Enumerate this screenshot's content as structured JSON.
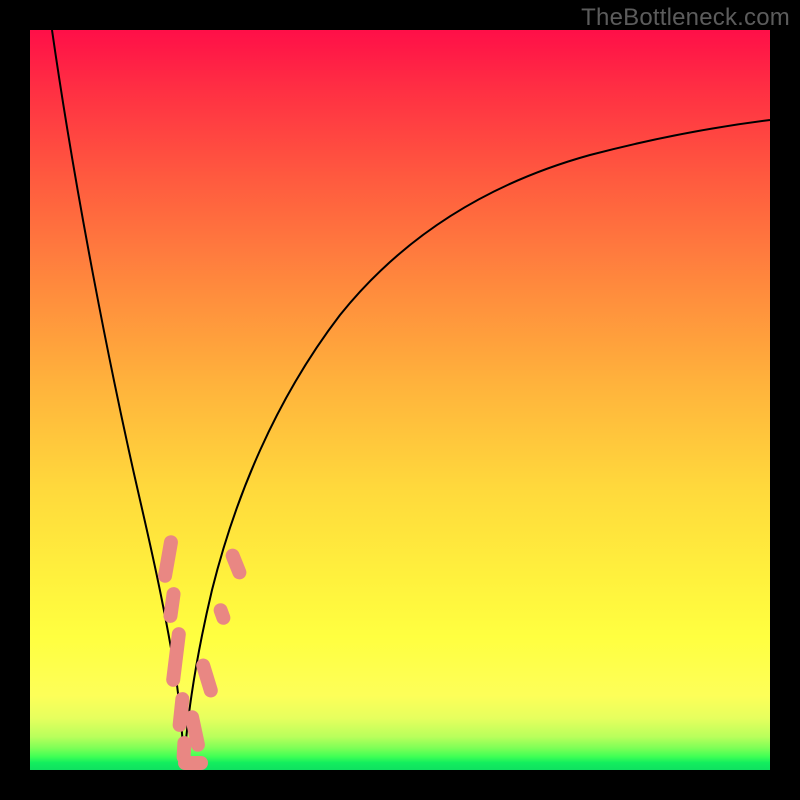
{
  "watermark": "TheBottleneck.com",
  "colors": {
    "frame": "#000000",
    "nugget": "#e98783",
    "curve": "#000000"
  },
  "chart_data": {
    "type": "line",
    "title": "",
    "xlabel": "",
    "ylabel": "",
    "xlim": [
      0,
      100
    ],
    "ylim": [
      0,
      100
    ],
    "grid": false,
    "series": [
      {
        "name": "left-branch",
        "x": [
          3,
          6,
          9,
          12,
          14,
          16,
          17.5,
          18.8,
          19.7,
          20.4,
          20.7
        ],
        "y": [
          100,
          75,
          54,
          36,
          24,
          16,
          10,
          6,
          3.5,
          1.5,
          0.6
        ]
      },
      {
        "name": "right-branch",
        "x": [
          20.7,
          21.5,
          23,
          25,
          28,
          32,
          38,
          46,
          56,
          68,
          82,
          100
        ],
        "y": [
          0.6,
          2,
          6,
          12,
          20,
          30,
          42,
          54,
          64,
          72,
          78,
          83
        ]
      }
    ],
    "markers": [
      {
        "name": "nugget",
        "x_range": [
          17.9,
          19.0
        ],
        "y_range": [
          27,
          37
        ]
      },
      {
        "name": "nugget",
        "x_range": [
          18.5,
          19.6
        ],
        "y_range": [
          20,
          27
        ]
      },
      {
        "name": "nugget",
        "x_range": [
          19.0,
          20.4
        ],
        "y_range": [
          9.5,
          20
        ]
      },
      {
        "name": "nugget",
        "x_range": [
          19.7,
          21.0
        ],
        "y_range": [
          3.5,
          9.5
        ]
      },
      {
        "name": "nugget",
        "x_range": [
          20.2,
          23.5
        ],
        "y_range": [
          0,
          3.5
        ]
      },
      {
        "name": "nugget",
        "x_range": [
          21.2,
          23.5
        ],
        "y_range": [
          3.5,
          9
        ]
      },
      {
        "name": "nugget",
        "x_range": [
          23.5,
          25.4
        ],
        "y_range": [
          9.5,
          17
        ]
      },
      {
        "name": "nugget",
        "x_range": [
          25.5,
          27.0
        ],
        "y_range": [
          19,
          24
        ]
      },
      {
        "name": "nugget",
        "x_range": [
          27.5,
          29.5
        ],
        "y_range": [
          26,
          32
        ]
      }
    ]
  }
}
